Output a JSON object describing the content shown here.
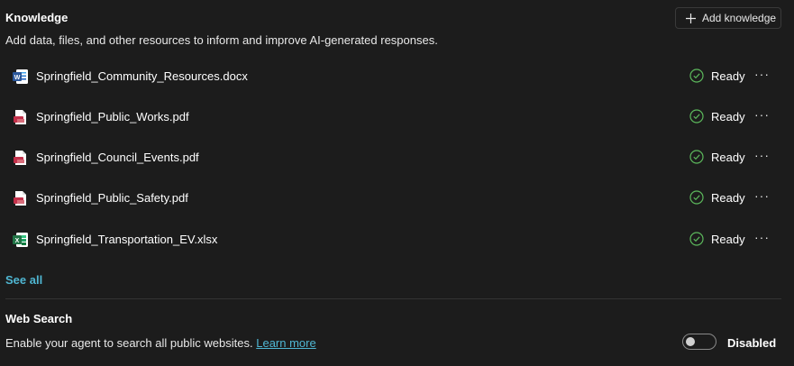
{
  "knowledge": {
    "title": "Knowledge",
    "description": "Add data, files, and other resources to inform and improve AI-generated responses.",
    "add_button_label": "Add knowledge",
    "files": [
      {
        "name": "Springfield_Community_Resources.docx",
        "type": "word-icon",
        "status": "Ready"
      },
      {
        "name": "Springfield_Public_Works.pdf",
        "type": "pdf-icon",
        "status": "Ready"
      },
      {
        "name": "Springfield_Council_Events.pdf",
        "type": "pdf-icon",
        "status": "Ready"
      },
      {
        "name": "Springfield_Public_Safety.pdf",
        "type": "pdf-icon",
        "status": "Ready"
      },
      {
        "name": "Springfield_Transportation_EV.xlsx",
        "type": "excel-icon",
        "status": "Ready"
      }
    ],
    "see_all_label": "See all"
  },
  "web_search": {
    "title": "Web Search",
    "description": "Enable your agent to search all public websites.",
    "learn_more_label": "Learn more",
    "toggle_state": "Disabled"
  },
  "colors": {
    "background": "#1c1c1c",
    "link": "#4fb6d2",
    "ready_green": "#5cb85c",
    "word_blue": "#2b579a",
    "excel_green": "#217346",
    "pdf_red": "#c4314b"
  }
}
